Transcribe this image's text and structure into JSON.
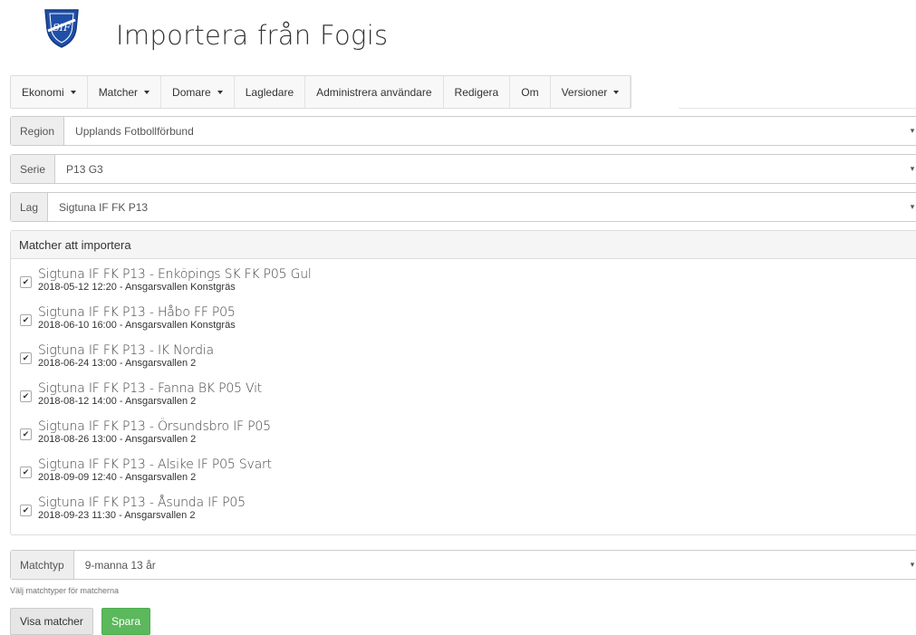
{
  "header": {
    "title": "Importera från Fogis"
  },
  "nav": {
    "items": [
      {
        "label": "Ekonomi",
        "dropdown": true
      },
      {
        "label": "Matcher",
        "dropdown": true
      },
      {
        "label": "Domare",
        "dropdown": true
      },
      {
        "label": "Lagledare",
        "dropdown": false
      },
      {
        "label": "Administrera användare",
        "dropdown": false
      },
      {
        "label": "Redigera",
        "dropdown": false
      },
      {
        "label": "Om",
        "dropdown": false
      },
      {
        "label": "Versioner",
        "dropdown": true
      }
    ]
  },
  "filters": {
    "region": {
      "label": "Region",
      "value": "Upplands Fotbollförbund"
    },
    "serie": {
      "label": "Serie",
      "value": "P13 G3"
    },
    "lag": {
      "label": "Lag",
      "value": "Sigtuna IF FK P13"
    }
  },
  "matches_panel": {
    "heading": "Matcher att importera",
    "matches": [
      {
        "title": "Sigtuna IF FK P13 - Enköpings SK FK P05 Gul",
        "details": "2018-05-12 12:20 - Ansgarsvallen Konstgräs",
        "checked": true
      },
      {
        "title": "Sigtuna IF FK P13 - Håbo FF P05",
        "details": "2018-06-10 16:00 - Ansgarsvallen Konstgräs",
        "checked": true
      },
      {
        "title": "Sigtuna IF FK P13 - IK Nordia",
        "details": "2018-06-24 13:00 - Ansgarsvallen 2",
        "checked": true
      },
      {
        "title": "Sigtuna IF FK P13 - Fanna BK P05 Vit",
        "details": "2018-08-12 14:00 - Ansgarsvallen 2",
        "checked": true
      },
      {
        "title": "Sigtuna IF FK P13 - Örsundsbro IF P05",
        "details": "2018-08-26 13:00 - Ansgarsvallen 2",
        "checked": true
      },
      {
        "title": "Sigtuna IF FK P13 - Alsike IF P05 Svart",
        "details": "2018-09-09 12:40 - Ansgarsvallen 2",
        "checked": true
      },
      {
        "title": "Sigtuna IF FK P13 - Åsunda IF P05",
        "details": "2018-09-23 11:30 - Ansgarsvallen 2",
        "checked": true
      }
    ]
  },
  "matchtyp": {
    "label": "Matchtyp",
    "value": "9-manna 13 år",
    "help": "Välj matchtyper för matcherna"
  },
  "buttons": {
    "show_matches": "Visa matcher",
    "save": "Spara"
  },
  "icons": {
    "logo": "club-crest-icon",
    "checkbox": "check-icon",
    "caret": "caret-down-icon"
  },
  "colors": {
    "primary_blue": "#1f4fa8",
    "success": "#5cb85c"
  }
}
